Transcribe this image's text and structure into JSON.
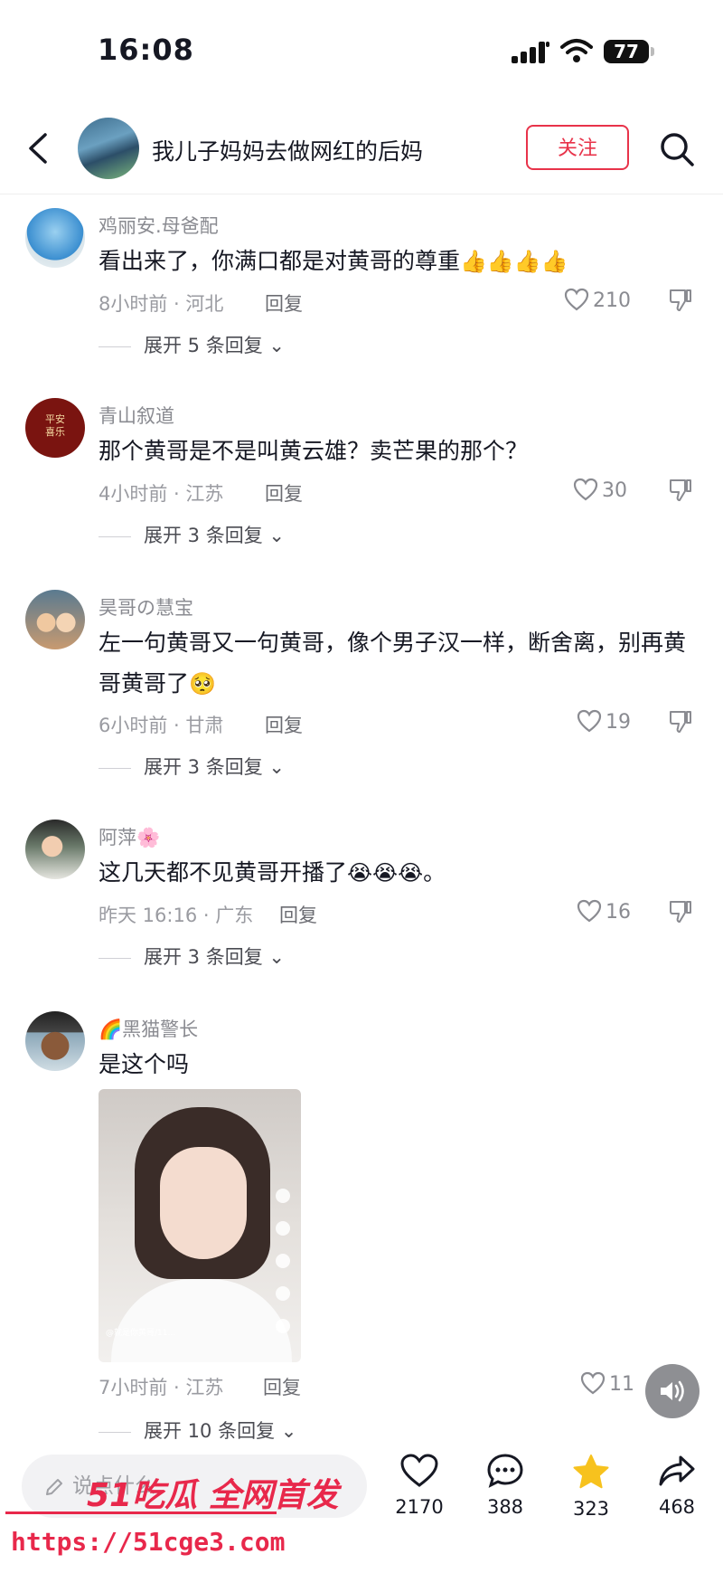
{
  "status_bar": {
    "time": "16:08",
    "battery": "77"
  },
  "header": {
    "title": "我儿子妈妈去做网红的后妈",
    "follow_label": "关注"
  },
  "comments": [
    {
      "name": "鸡丽安.母爸配",
      "text": "看出来了，你满口都是对黄哥的尊重",
      "emoji": "👍👍👍👍",
      "meta": "8小时前 · 河北",
      "reply": "回复",
      "likes": "210",
      "expand": "展开 5 条回复"
    },
    {
      "name": "青山叙道",
      "text": "那个黄哥是不是叫黄云雄？卖芒果的那个？",
      "emoji": "",
      "meta": "4小时前 · 江苏",
      "reply": "回复",
      "likes": "30",
      "expand": "展开 3 条回复",
      "avatar_text": "平安喜乐"
    },
    {
      "name": "昊哥の慧宝",
      "text": "左一句黄哥又一句黄哥，像个男子汉一样，断舍离，别再黄哥黄哥了",
      "emoji": "🥺",
      "meta": "6小时前 · 甘肃",
      "reply": "回复",
      "likes": "19",
      "expand": "展开 3 条回复"
    },
    {
      "name": "阿萍",
      "name_emoji": "🌸",
      "text": "这几天都不见黄哥开播了",
      "emoji": "😭😭😭",
      "text_tail": "。",
      "meta": "昨天 16:16 · 广东",
      "reply": "回复",
      "likes": "16",
      "expand": "展开 3 条回复"
    },
    {
      "name": "黑猫警长",
      "name_emoji": "🌈",
      "text": "是这个吗",
      "emoji": "",
      "meta": "7小时前 · 江苏",
      "reply": "回复",
      "likes": "11",
      "expand": "展开 10 条回复",
      "video_caption": "@就是你黄哥/11..."
    }
  ],
  "bottom_bar": {
    "input_placeholder": "说点什么",
    "likes": "2170",
    "comments": "388",
    "favorites": "323",
    "shares": "468"
  },
  "watermark": {
    "brand": "51吃瓜 全网首发",
    "url": "https://51cge3.com"
  },
  "colors": {
    "accent": "#e8334a",
    "star": "#f7c21e",
    "text": "#161823",
    "muted": "#8a8b91"
  }
}
